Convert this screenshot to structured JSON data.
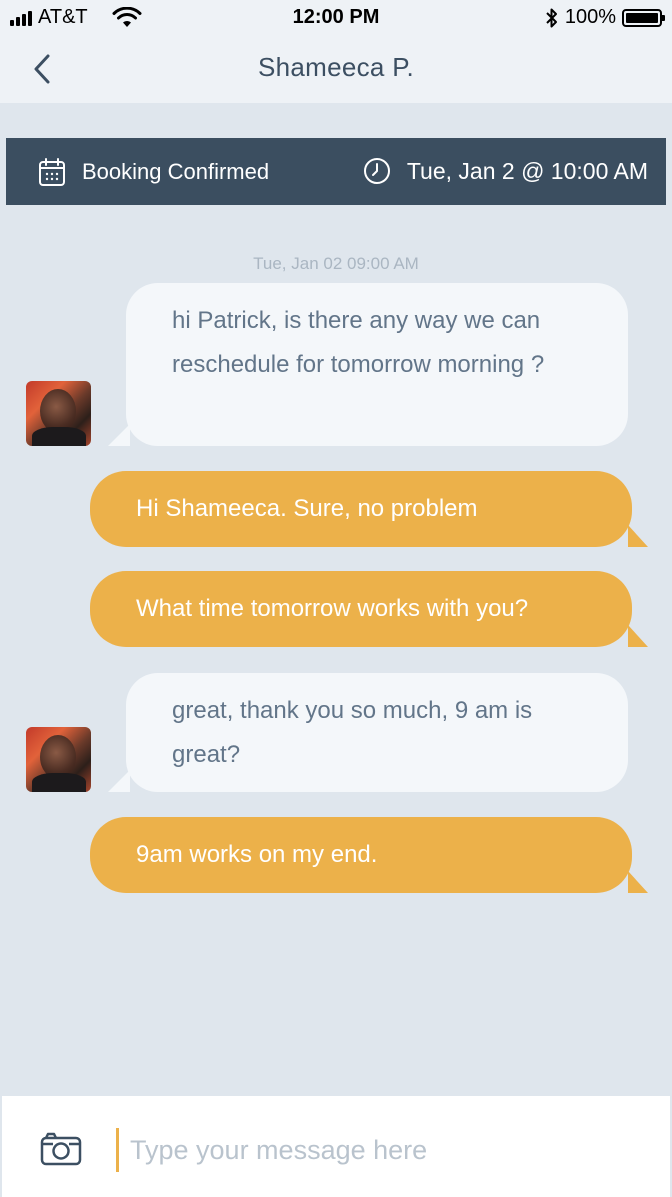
{
  "status_bar": {
    "carrier": "AT&T",
    "time": "12:00 PM",
    "battery": "100%"
  },
  "nav": {
    "title": "Shameeca P.",
    "back_icon": "chevron-left-icon"
  },
  "booking": {
    "status": "Booking Confirmed",
    "datetime": "Tue, Jan 2 @ 10:00 AM"
  },
  "chat": {
    "timestamp": "Tue, Jan 02 09:00 AM",
    "messages": [
      {
        "from": "them",
        "text": "hi Patrick, is there any way we can reschedule for tomorrow morning ?"
      },
      {
        "from": "me",
        "text": "Hi Shameeca. Sure, no problem"
      },
      {
        "from": "me",
        "text": "What time tomorrow works with you?"
      },
      {
        "from": "them",
        "text": "great, thank you so much, 9 am is great?"
      },
      {
        "from": "me",
        "text": "9am works on my end."
      }
    ]
  },
  "composer": {
    "placeholder": "Type your message here",
    "value": ""
  },
  "colors": {
    "background": "#dfe6ed",
    "banner": "#3b4e60",
    "outgoing_bubble": "#ecb14a",
    "incoming_bubble": "#f4f7fa",
    "incoming_text": "#627589"
  }
}
